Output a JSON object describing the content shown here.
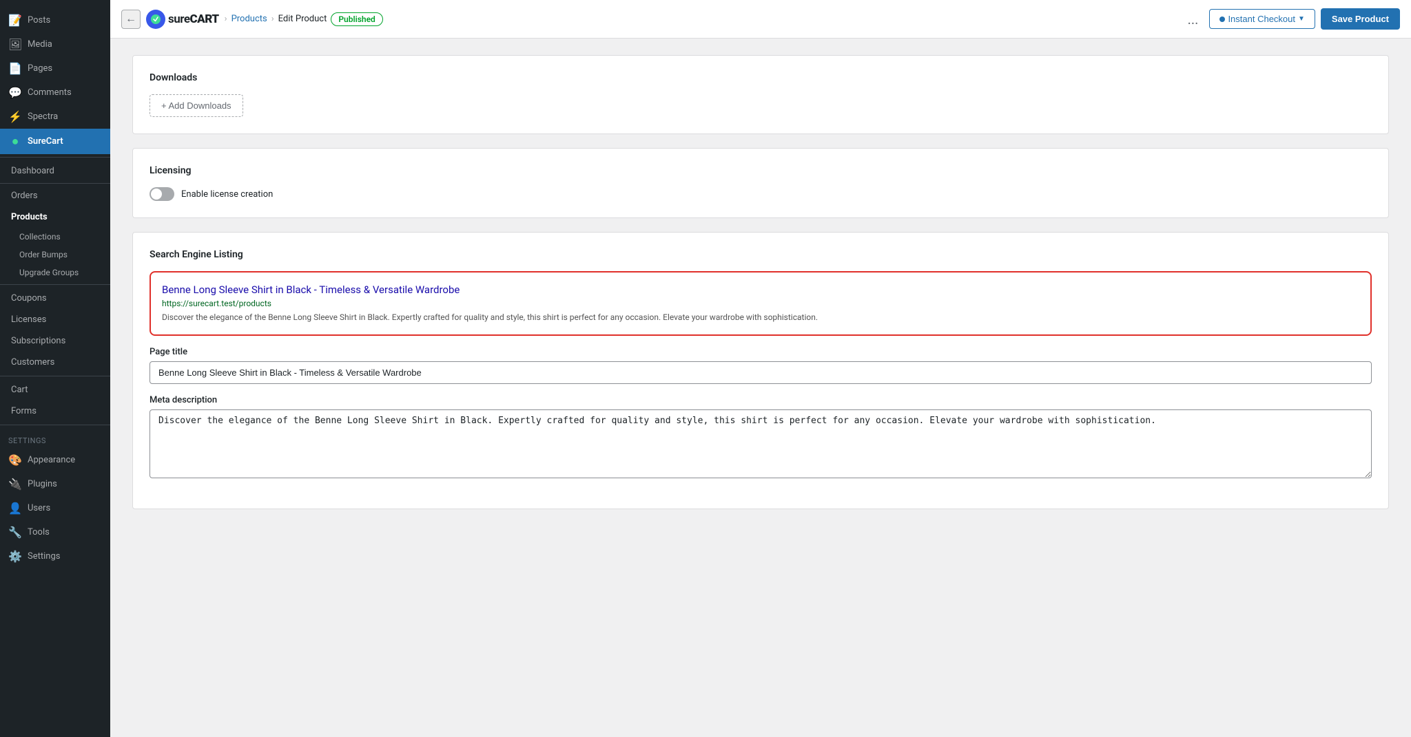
{
  "sidebar": {
    "items": [
      {
        "id": "posts",
        "label": "Posts",
        "icon": "📝"
      },
      {
        "id": "media",
        "label": "Media",
        "icon": "🖼"
      },
      {
        "id": "pages",
        "label": "Pages",
        "icon": "📄"
      },
      {
        "id": "comments",
        "label": "Comments",
        "icon": "💬"
      },
      {
        "id": "spectra",
        "label": "Spectra",
        "icon": "⚡"
      },
      {
        "id": "surecart",
        "label": "SureCart",
        "icon": "●",
        "active": true
      }
    ],
    "surecart_section": {
      "dashboard": "Dashboard",
      "orders": "Orders",
      "products": "Products",
      "collections": "Collections",
      "order_bumps": "Order Bumps",
      "upgrade_groups": "Upgrade Groups",
      "coupons": "Coupons",
      "licenses": "Licenses",
      "subscriptions": "Subscriptions",
      "customers": "Customers",
      "cart": "Cart",
      "forms": "Forms",
      "settings_label": "Settings",
      "appearance": "Appearance",
      "plugins": "Plugins",
      "users": "Users",
      "tools": "Tools",
      "settings": "Settings"
    }
  },
  "topbar": {
    "logo_text_sure": "sure",
    "logo_text_cart": "CART",
    "breadcrumb_products": "Products",
    "breadcrumb_edit": "Edit Product",
    "breadcrumb_status": "Published",
    "page_title": "Products",
    "dots_label": "...",
    "instant_checkout_label": "Instant Checkout",
    "save_product_label": "Save Product"
  },
  "downloads_section": {
    "title": "Downloads",
    "add_button_label": "+ Add Downloads"
  },
  "licensing_section": {
    "title": "Licensing",
    "toggle_label": "Enable license creation",
    "toggle_on": false
  },
  "seo_section": {
    "title": "Search Engine Listing",
    "preview_title": "Benne Long Sleeve Shirt in Black - Timeless & Versatile Wardrobe",
    "preview_url": "https://surecart.test/products",
    "preview_desc": "Discover the elegance of the Benne Long Sleeve Shirt in Black. Expertly crafted for quality and style, this shirt is perfect for any occasion. Elevate your wardrobe with sophistication.",
    "page_title_label": "Page title",
    "page_title_value": "Benne Long Sleeve Shirt in Black - Timeless & Versatile Wardrobe",
    "meta_desc_label": "Meta description",
    "meta_desc_value": "Discover the elegance of the Benne Long Sleeve Shirt in Black. Expertly crafted for quality and style, this shirt is perfect for any occasion. Elevate your wardrobe with sophistication."
  }
}
